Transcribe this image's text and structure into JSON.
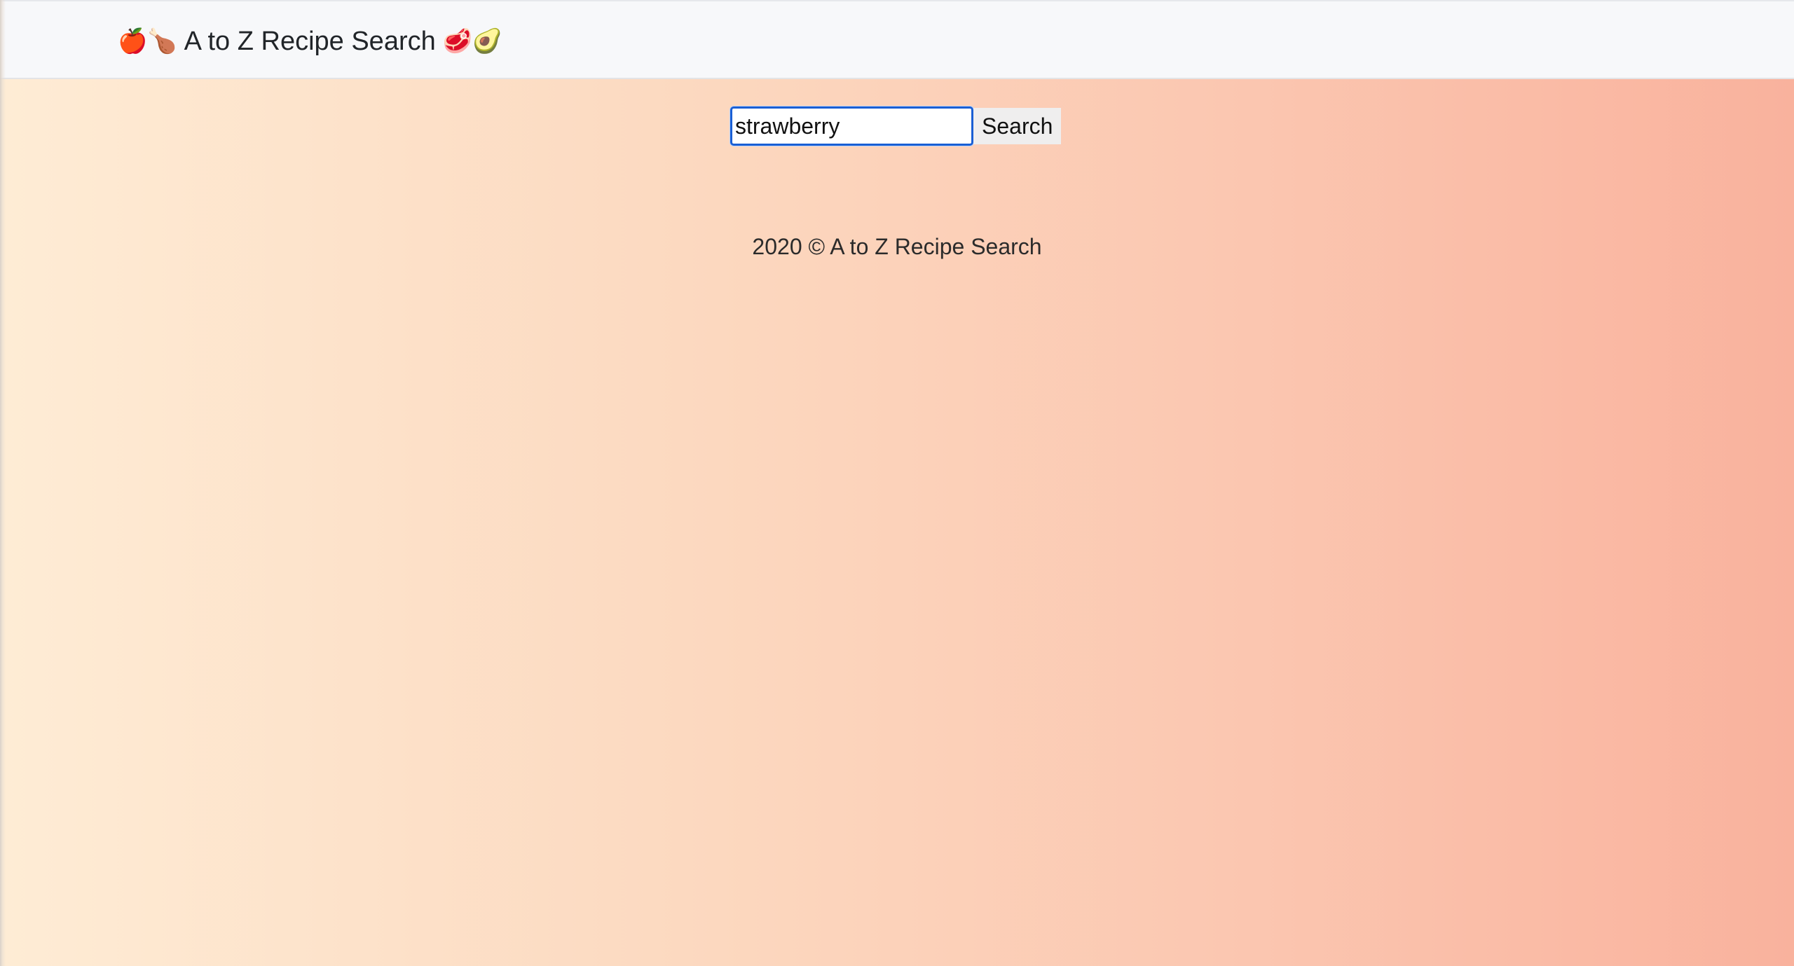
{
  "navbar": {
    "brand_emoji_left": "🍎🍗",
    "brand_title": "A to Z Recipe Search",
    "brand_emoji_right": "🥩🥑"
  },
  "search": {
    "value": "strawberry",
    "button_label": "Search"
  },
  "footer": {
    "text": "2020 © A to Z Recipe Search"
  }
}
